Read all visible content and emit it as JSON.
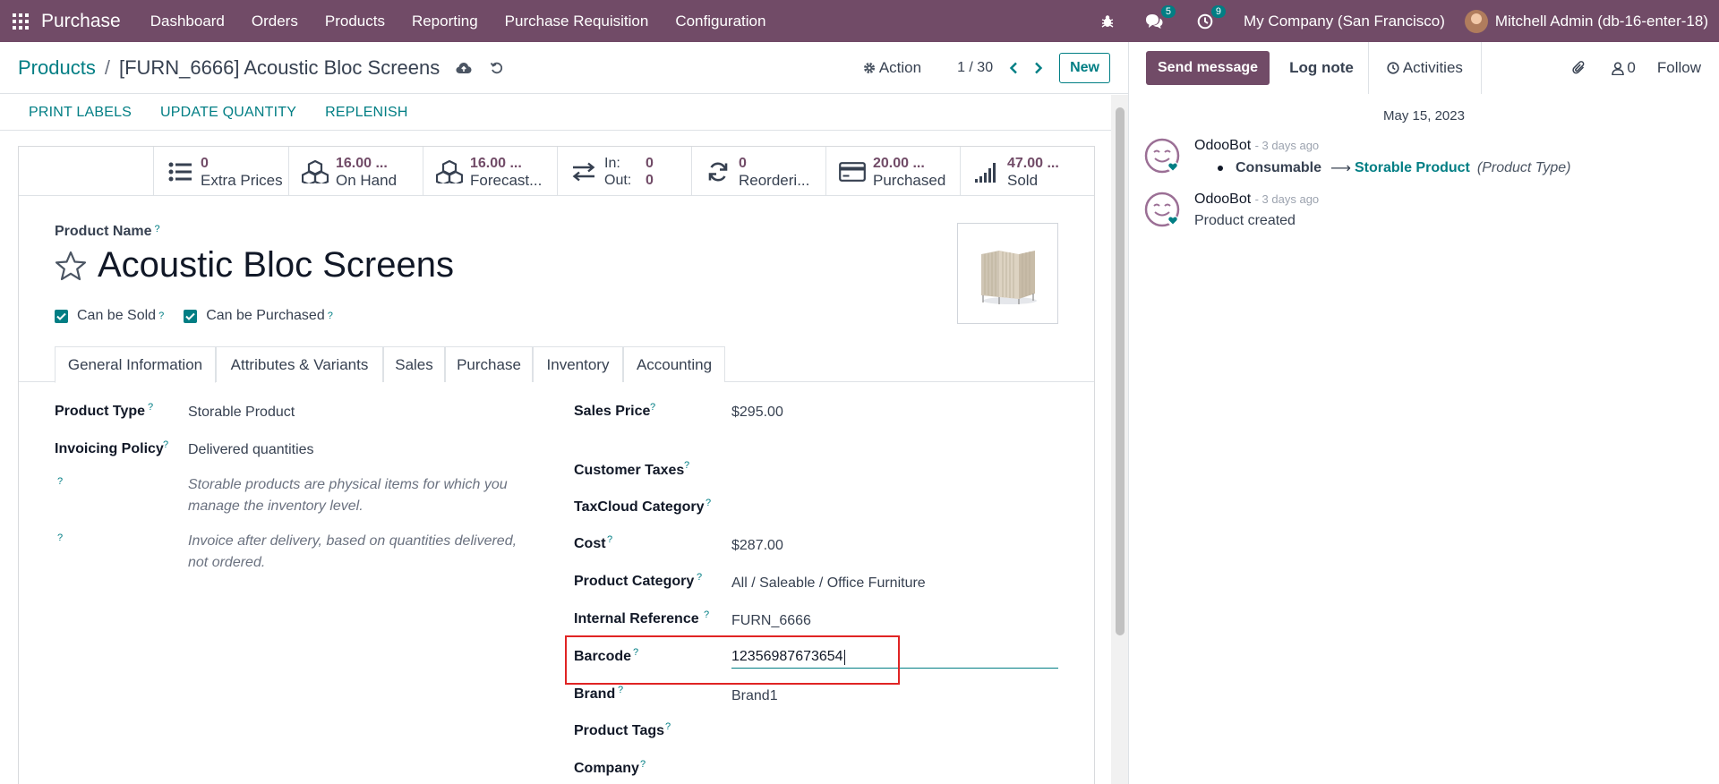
{
  "topbar": {
    "app_name": "Purchase",
    "menu": [
      "Dashboard",
      "Orders",
      "Products",
      "Reporting",
      "Purchase Requisition",
      "Configuration"
    ],
    "messages_count": "5",
    "activities_count": "9",
    "company": "My Company (San Francisco)",
    "user": "Mitchell Admin (db-16-enter-18)"
  },
  "control": {
    "breadcrumb_root": "Products",
    "breadcrumb_sep": "/",
    "breadcrumb_current": "[FURN_6666] Acoustic Bloc Screens",
    "action_label": "Action",
    "pager": "1 / 30",
    "new_label": "New"
  },
  "statusbar": {
    "buttons": [
      "PRINT LABELS",
      "UPDATE QUANTITY",
      "REPLENISH"
    ]
  },
  "stats": {
    "extra_prices": {
      "value": "0",
      "label": "Extra Prices"
    },
    "on_hand": {
      "value": "16.00 ...",
      "label": "On Hand"
    },
    "forecast": {
      "value": "16.00 ...",
      "label": "Forecast..."
    },
    "inout": {
      "in_label": "In:",
      "in_value": "0",
      "out_label": "Out:",
      "out_value": "0"
    },
    "reordering": {
      "value": "0",
      "label": "Reorderi..."
    },
    "purchased": {
      "value": "20.00 ...",
      "label": "Purchased"
    },
    "sold": {
      "value": "47.00 ...",
      "label": "Sold"
    }
  },
  "product": {
    "name_label": "Product Name",
    "name": "Acoustic Bloc Screens",
    "can_be_sold": "Can be Sold",
    "can_be_purchased": "Can be Purchased"
  },
  "tabs": [
    "General Information",
    "Attributes & Variants",
    "Sales",
    "Purchase",
    "Inventory",
    "Accounting"
  ],
  "general": {
    "product_type_label": "Product Type",
    "product_type": "Storable Product",
    "invoicing_policy_label": "Invoicing Policy",
    "invoicing_policy": "Delivered quantities",
    "help_1": "Storable products are physical items for which you manage the inventory level.",
    "help_2": "Invoice after delivery, based on quantities delivered, not ordered.",
    "sales_price_label": "Sales Price",
    "sales_price": "$295.00",
    "customer_taxes_label": "Customer Taxes",
    "taxcloud_label": "TaxCloud Category",
    "cost_label": "Cost",
    "cost": "$287.00",
    "category_label": "Product Category",
    "category": "All / Saleable / Office Furniture",
    "internal_ref_label": "Internal Reference",
    "internal_ref": "FURN_6666",
    "barcode_label": "Barcode",
    "barcode": "12356987673654",
    "brand_label": "Brand",
    "brand": "Brand1",
    "tags_label": "Product Tags",
    "company_label": "Company"
  },
  "chatter": {
    "send_message": "Send message",
    "log_note": "Log note",
    "activities": "Activities",
    "followers_count": "0",
    "follow": "Follow",
    "date": "May 15, 2023",
    "messages": [
      {
        "author": "OdooBot",
        "time": "- 3 days ago",
        "old": "Consumable",
        "arrow": "⟶",
        "new": "Storable Product",
        "field": "(Product Type)"
      },
      {
        "author": "OdooBot",
        "time": "- 3 days ago",
        "body": "Product created"
      }
    ]
  }
}
